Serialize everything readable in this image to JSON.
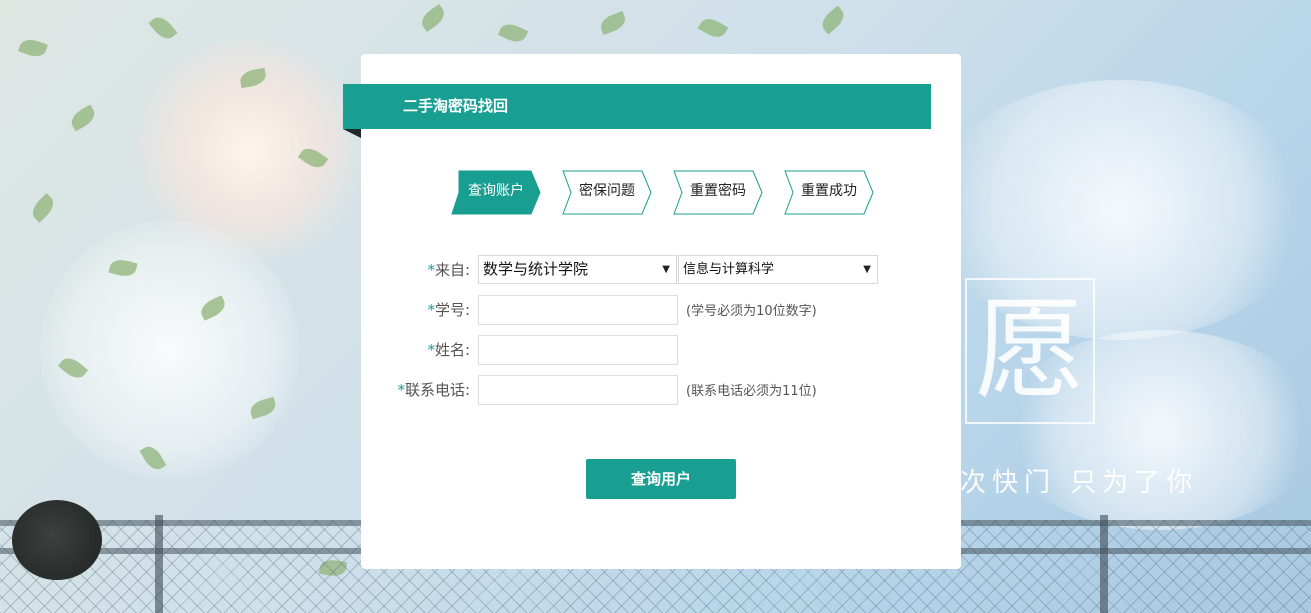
{
  "header": {
    "title": "二手淘密码找回"
  },
  "steps": [
    {
      "label": "查询账户",
      "active": true
    },
    {
      "label": "密保问题",
      "active": false
    },
    {
      "label": "重置密码",
      "active": false
    },
    {
      "label": "重置成功",
      "active": false
    }
  ],
  "form": {
    "required_mark": "*",
    "from": {
      "label": "来自:",
      "college": "数学与统计学院",
      "major": "信息与计算科学"
    },
    "student_id": {
      "label": "学号:",
      "value": "",
      "hint": "(学号必须为10位数字)"
    },
    "name": {
      "label": "姓名:",
      "value": ""
    },
    "phone": {
      "label": "联系电话:",
      "value": "",
      "hint": "(联系电话必须为11位)"
    },
    "submit_label": "查询用户"
  },
  "background": {
    "calligraphy": "愿",
    "slogan": "次快门 只为了你"
  },
  "colors": {
    "accent": "#199f92"
  }
}
